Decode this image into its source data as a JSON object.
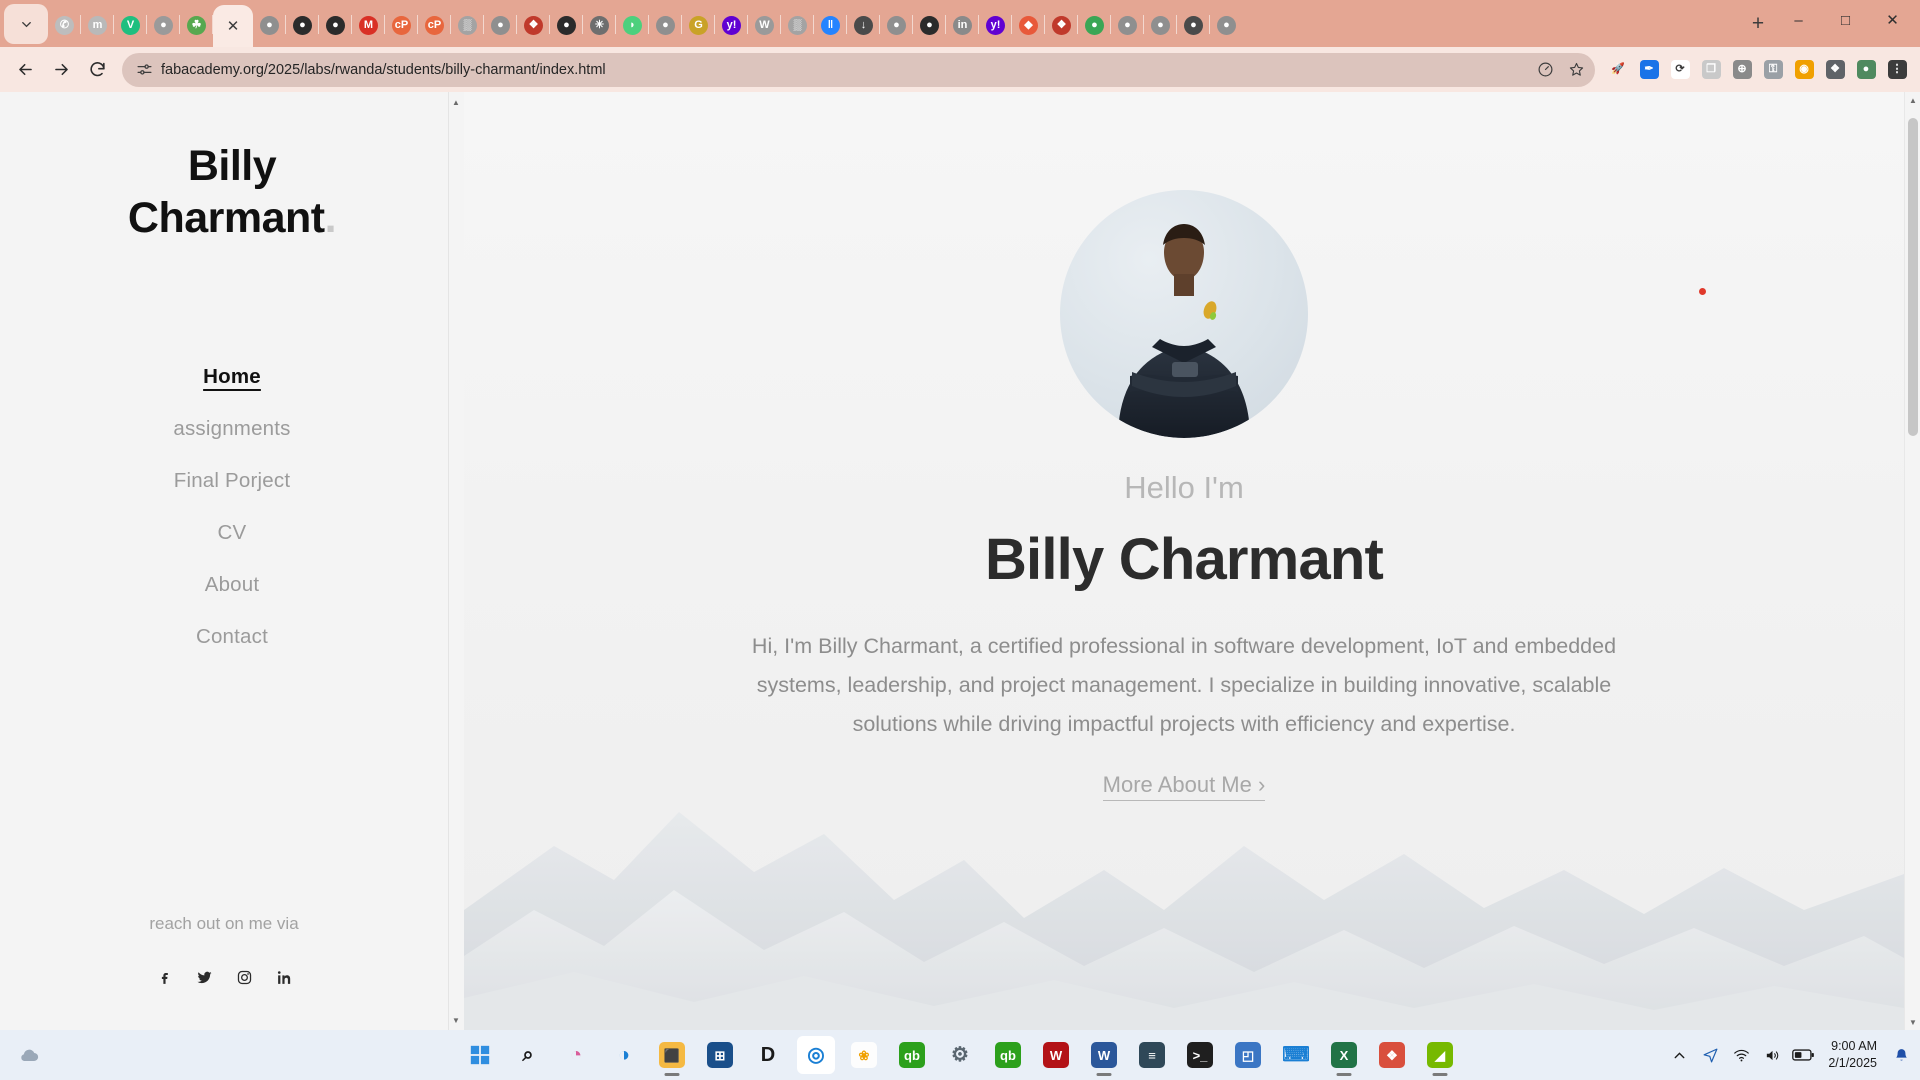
{
  "browser": {
    "tab_list_icon": "chevron-down-icon",
    "new_tab_label": "+",
    "window_controls": {
      "minimize": "–",
      "maximize": "□",
      "close": "✕"
    },
    "tabs": [
      {
        "name": "whatsapp",
        "glyph": "✆",
        "color": "#bdbdbd",
        "active": false
      },
      {
        "name": "moodle",
        "glyph": "m",
        "color": "#b9b9b9",
        "active": false
      },
      {
        "name": "vimeo",
        "glyph": "V",
        "color": "#1fbf7f",
        "active": false
      },
      {
        "name": "globe-page",
        "glyph": "●",
        "color": "#9a9a9a",
        "active": false
      },
      {
        "name": "tree-site",
        "glyph": "☘",
        "color": "#57a84f",
        "active": false
      },
      {
        "name": "current-tab",
        "glyph": "✕",
        "color": "#ffffff",
        "active": true
      },
      {
        "name": "globe-page-2",
        "glyph": "●",
        "color": "#8f8f8f",
        "active": false
      },
      {
        "name": "github",
        "glyph": "●",
        "color": "#2b2b2b",
        "active": false
      },
      {
        "name": "github-2",
        "glyph": "●",
        "color": "#2b2b2b",
        "active": false
      },
      {
        "name": "gmail",
        "glyph": "M",
        "color": "#d93025",
        "active": false
      },
      {
        "name": "codepen",
        "glyph": "cP",
        "color": "#e8663d",
        "active": false
      },
      {
        "name": "codepen-2",
        "glyph": "cP",
        "color": "#e8663d",
        "active": false
      },
      {
        "name": "docs-site",
        "glyph": "▒",
        "color": "#a3a3a3",
        "active": false
      },
      {
        "name": "globe-page-3",
        "glyph": "●",
        "color": "#8f8f8f",
        "active": false
      },
      {
        "name": "colorful-site",
        "glyph": "❖",
        "color": "#c0392b",
        "active": false
      },
      {
        "name": "github-3",
        "glyph": "●",
        "color": "#2b2b2b",
        "active": false
      },
      {
        "name": "openai",
        "glyph": "✳",
        "color": "#6e6e6e",
        "active": false
      },
      {
        "name": "evernote",
        "glyph": "◗",
        "color": "#4cd07d",
        "active": false
      },
      {
        "name": "globe-page-4",
        "glyph": "●",
        "color": "#8f8f8f",
        "active": false
      },
      {
        "name": "google-site",
        "glyph": "G",
        "color": "#c9a227",
        "active": false
      },
      {
        "name": "yahoo",
        "glyph": "y!",
        "color": "#6001d2",
        "active": false
      },
      {
        "name": "wiki",
        "glyph": "W",
        "color": "#9a9a9a",
        "active": false
      },
      {
        "name": "scholar",
        "glyph": "▒",
        "color": "#a3a3a3",
        "active": false
      },
      {
        "name": "bitbucket",
        "glyph": "‖",
        "color": "#2684ff",
        "active": false
      },
      {
        "name": "downloads-tab",
        "glyph": "↓",
        "color": "#4a4a4a",
        "active": false
      },
      {
        "name": "globe-page-5",
        "glyph": "●",
        "color": "#8f8f8f",
        "active": false
      },
      {
        "name": "github-4",
        "glyph": "●",
        "color": "#2b2b2b",
        "active": false
      },
      {
        "name": "info-site",
        "glyph": "in",
        "color": "#8a8a8a",
        "active": false
      },
      {
        "name": "yahoo-2",
        "glyph": "y!",
        "color": "#6001d2",
        "active": false
      },
      {
        "name": "diamond-site",
        "glyph": "◆",
        "color": "#e8593a",
        "active": false
      },
      {
        "name": "colorful-site-2",
        "glyph": "❖",
        "color": "#c0392b",
        "active": false
      },
      {
        "name": "green-globe",
        "glyph": "●",
        "color": "#3aa655",
        "active": false
      },
      {
        "name": "globe-page-6",
        "glyph": "●",
        "color": "#8f8f8f",
        "active": false
      },
      {
        "name": "globe-page-7",
        "glyph": "●",
        "color": "#8f8f8f",
        "active": false
      },
      {
        "name": "globe-page-8",
        "glyph": "●",
        "color": "#4a4a4a",
        "active": false
      },
      {
        "name": "globe-page-9",
        "glyph": "●",
        "color": "#8f8f8f",
        "active": false
      }
    ],
    "toolbar": {
      "back": "back-arrow-icon",
      "forward": "forward-arrow-icon",
      "reload": "reload-icon",
      "site_info": "tune-settings-icon",
      "url": "fabacademy.org/2025/labs/rwanda/students/billy-charmant/index.html",
      "performance": "performance-gauge-icon",
      "bookmark": "star-icon",
      "extensions_label": "extensions-puzzle-icon",
      "menu_label": "three-dot-menu-icon"
    },
    "extensions": [
      {
        "name": "rocket-extension",
        "glyph": "🚀",
        "color": "transparent"
      },
      {
        "name": "pen-extension",
        "glyph": "✒",
        "color": "#1a73e8"
      },
      {
        "name": "sync-extension",
        "glyph": "⟳",
        "color": "#ffffff"
      },
      {
        "name": "screenshot-extension",
        "glyph": "❐",
        "color": "#c9c9c9"
      },
      {
        "name": "translate-globe-extension",
        "glyph": "⊕",
        "color": "#8a8a8a"
      },
      {
        "name": "password-extension",
        "glyph": "⚿",
        "color": "#9aa0a6"
      },
      {
        "name": "color-picker-extension",
        "glyph": "◉",
        "color": "#f0a000"
      },
      {
        "name": "puzzle-extensions-button",
        "glyph": "❖",
        "color": "#5f6368"
      },
      {
        "name": "profile-avatar",
        "glyph": "●",
        "color": "#4f8a5f"
      },
      {
        "name": "chrome-menu",
        "glyph": "⋮",
        "color": "#3c3c3c"
      }
    ]
  },
  "page": {
    "sidebar": {
      "logo_line1": "Billy",
      "logo_line2": "Charmant",
      "logo_dot": ".",
      "nav": [
        {
          "label": "Home",
          "active": true
        },
        {
          "label": "assignments",
          "active": false
        },
        {
          "label": "Final Porject",
          "active": false
        },
        {
          "label": "CV",
          "active": false
        },
        {
          "label": "About",
          "active": false
        },
        {
          "label": "Contact",
          "active": false
        }
      ],
      "reach_out": "reach out on me via",
      "socials": [
        {
          "name": "facebook-icon",
          "label": "f"
        },
        {
          "name": "twitter-icon",
          "label": "t"
        },
        {
          "name": "instagram-icon",
          "label": "ig"
        },
        {
          "name": "linkedin-icon",
          "label": "in"
        }
      ]
    },
    "hero": {
      "avatar_name": "profile-photo",
      "greeting": "Hello I'm",
      "name": "Billy Charmant",
      "blurb": "Hi, I'm Billy Charmant, a certified professional in software development, IoT and embedded systems, leadership, and project management. I specialize in building innovative, scalable solutions while driving impactful projects with efficiency and expertise.",
      "cta": "More About Me ›",
      "accent_color": "#e0392b"
    }
  },
  "taskbar": {
    "start": {
      "name": "start-button",
      "glyph": "⊞"
    },
    "items": [
      {
        "name": "search-taskbar",
        "glyph": "⌕",
        "color": "transparent",
        "text": "#1b1b1b",
        "state": ""
      },
      {
        "name": "copilot-taskbar",
        "glyph": "◔",
        "color": "transparent",
        "text": "#d95c9a",
        "state": ""
      },
      {
        "name": "edge-taskbar",
        "glyph": "◑",
        "color": "transparent",
        "text": "#1a7fd4",
        "state": ""
      },
      {
        "name": "file-explorer-taskbar",
        "glyph": "⬛",
        "color": "#f5b942",
        "text": "#f5b942",
        "state": "running"
      },
      {
        "name": "microsoft-store-taskbar",
        "glyph": "⊞",
        "color": "#1a4f8a",
        "text": "#ffffff",
        "state": ""
      },
      {
        "name": "dell-taskbar",
        "glyph": "D",
        "color": "transparent",
        "text": "#1b1b1b",
        "state": ""
      },
      {
        "name": "chrome-taskbar",
        "glyph": "◎",
        "color": "transparent",
        "text": "#1a7fd4",
        "state": "focused"
      },
      {
        "name": "photos-taskbar",
        "glyph": "❀",
        "color": "#fdfdfd",
        "text": "#f0a000",
        "state": ""
      },
      {
        "name": "quickbooks-taskbar",
        "glyph": "qb",
        "color": "#2ca01c",
        "text": "#ffffff",
        "state": ""
      },
      {
        "name": "settings-taskbar",
        "glyph": "⚙",
        "color": "transparent",
        "text": "#5a6670",
        "state": ""
      },
      {
        "name": "quickbooks-2-taskbar",
        "glyph": "qb",
        "color": "#2ca01c",
        "text": "#ffffff",
        "state": ""
      },
      {
        "name": "news-taskbar",
        "glyph": "W",
        "color": "#b31217",
        "text": "#ffffff",
        "state": ""
      },
      {
        "name": "word-taskbar",
        "glyph": "W",
        "color": "#2b579a",
        "text": "#ffffff",
        "state": "running"
      },
      {
        "name": "calculator-taskbar",
        "glyph": "≡",
        "color": "#2f4858",
        "text": "#ffffff",
        "state": ""
      },
      {
        "name": "terminal-taskbar",
        "glyph": ">_",
        "color": "#1f1f1f",
        "text": "#ffffff",
        "state": ""
      },
      {
        "name": "paint-taskbar",
        "glyph": "◰",
        "color": "#3b76c4",
        "text": "#ffffff",
        "state": ""
      },
      {
        "name": "vscode-taskbar",
        "glyph": "⌨",
        "color": "transparent",
        "text": "#1a7fd4",
        "state": ""
      },
      {
        "name": "excel-taskbar",
        "glyph": "X",
        "color": "#217346",
        "text": "#ffffff",
        "state": "running"
      },
      {
        "name": "gallery-taskbar",
        "glyph": "❖",
        "color": "#d94f3d",
        "text": "#ffffff",
        "state": ""
      },
      {
        "name": "nvidia-taskbar",
        "glyph": "◢",
        "color": "#76b900",
        "text": "#ffffff",
        "state": "running"
      }
    ],
    "tray": {
      "show_hidden": "chevron-up-icon",
      "location": "location-arrow-icon",
      "wifi": "wifi-icon",
      "volume": "speaker-icon",
      "battery": "battery-icon",
      "time": "9:00 AM",
      "date": "2/1/2025",
      "notifications": "bell-icon"
    }
  }
}
